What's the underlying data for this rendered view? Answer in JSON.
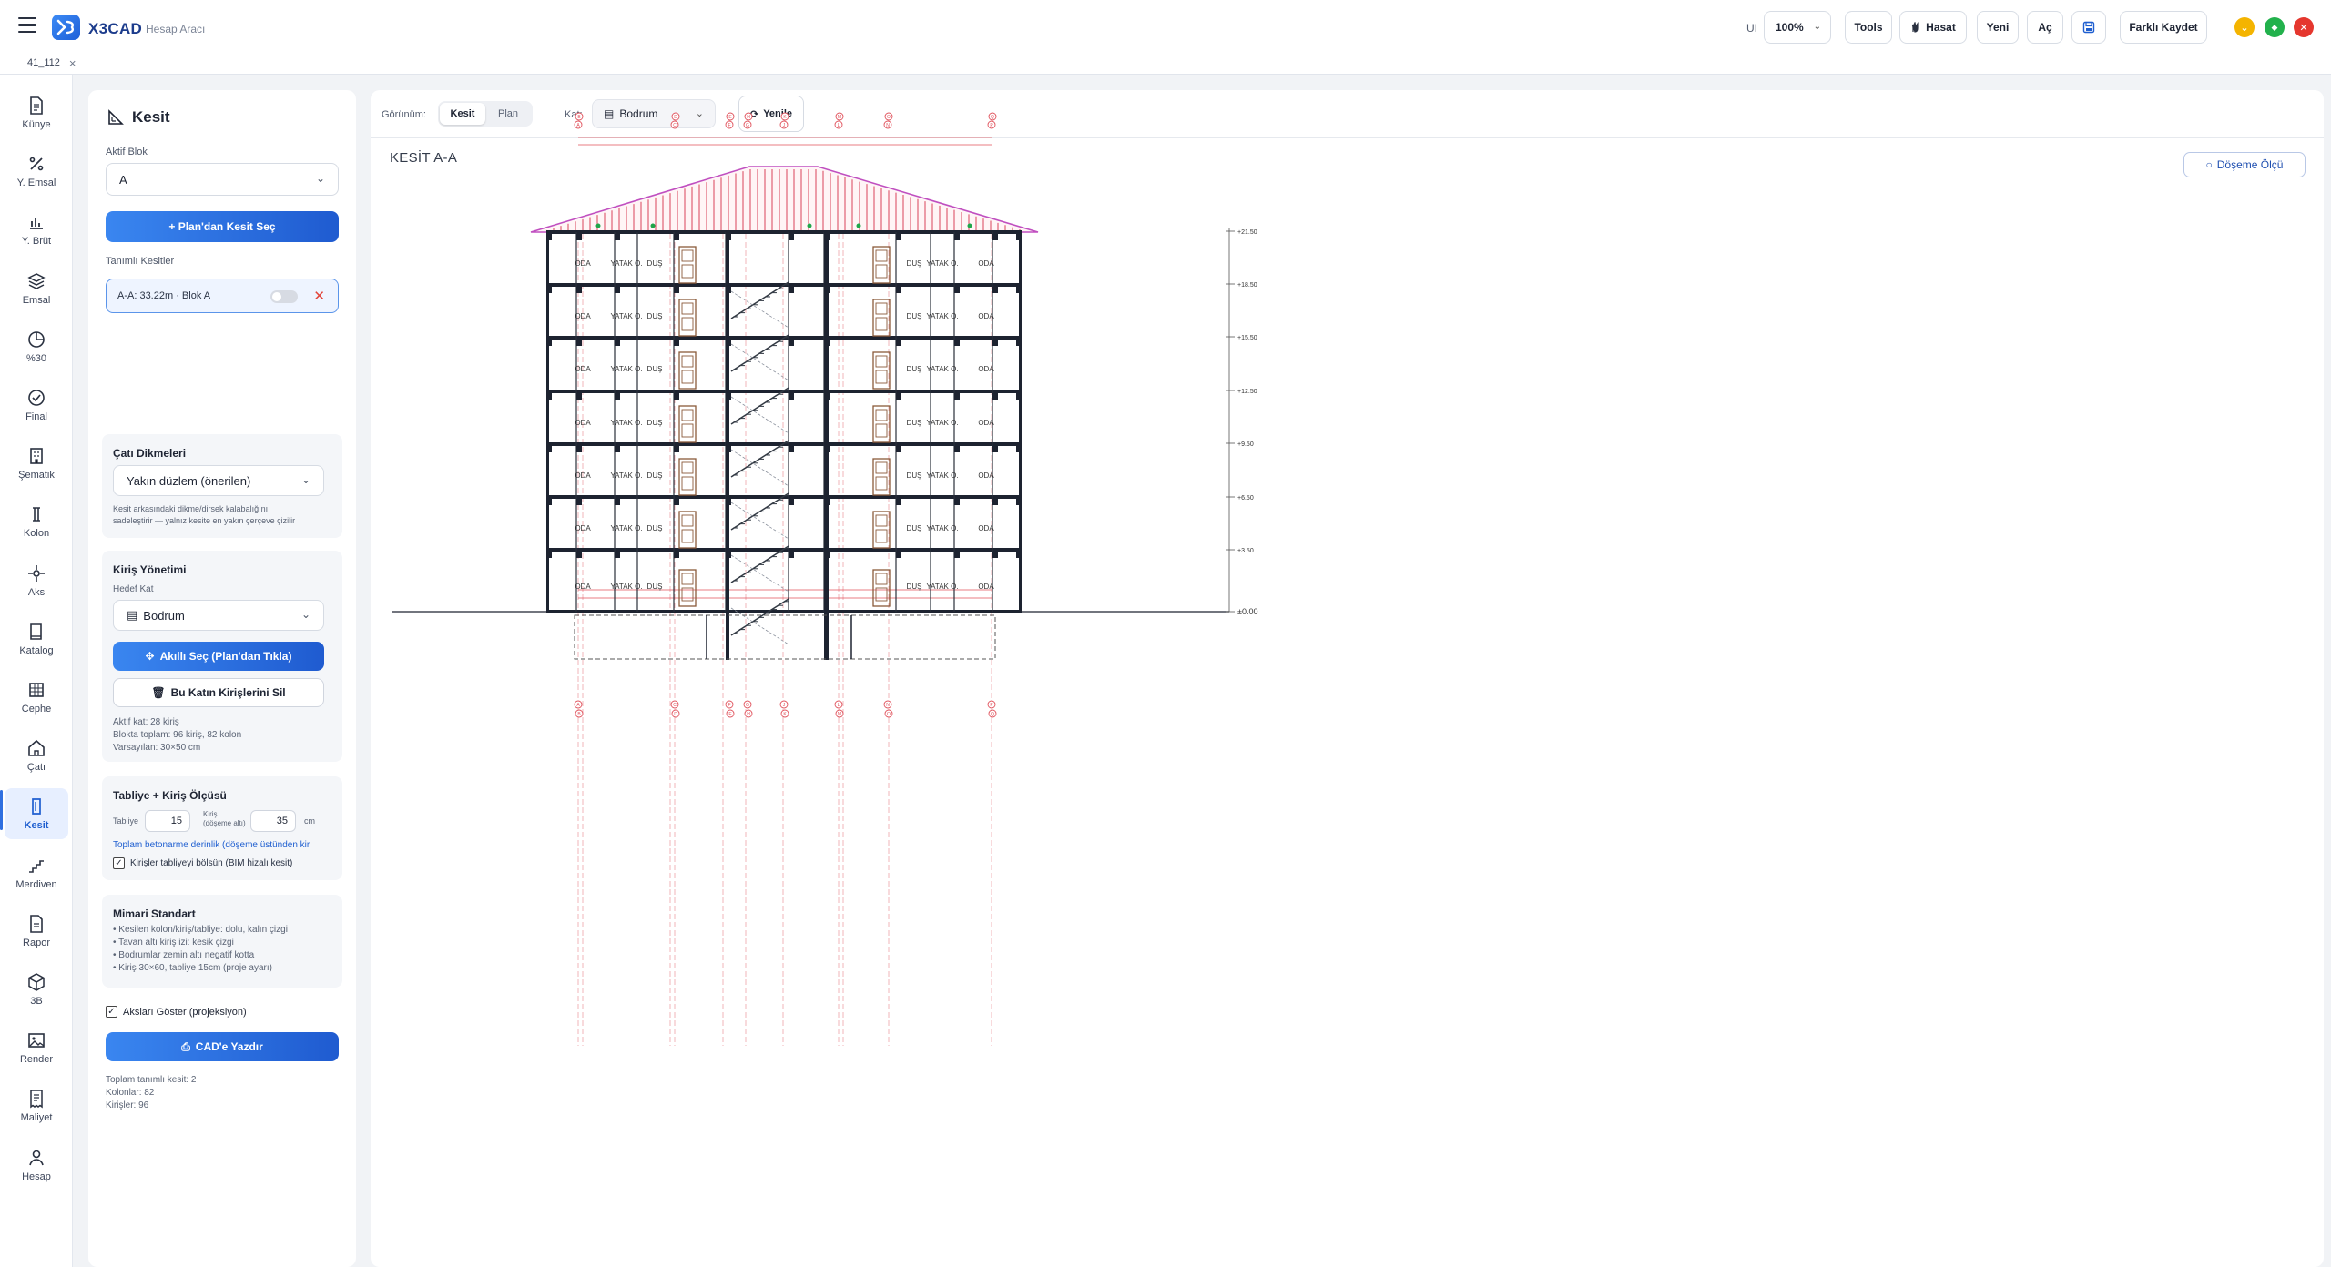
{
  "app": {
    "name": "X3CAD",
    "subtitle": "Hesap Aracı"
  },
  "file_tab": {
    "name": "41_112",
    "close": "×"
  },
  "toolbar": {
    "ui_label": "UI",
    "zoom_value": "100%",
    "tools": "Tools",
    "hasat": "Hasat",
    "yeni": "Yeni",
    "ac": "Aç",
    "farkli_kaydet": "Farklı Kaydet"
  },
  "window_controls": {
    "minimize_color": "#f4b400",
    "maximize_color": "#22b14c",
    "close_color": "#e5372e"
  },
  "nav": [
    {
      "label": "Künye",
      "icon": "document-icon"
    },
    {
      "label": "Y. Emsal",
      "icon": "percent-icon"
    },
    {
      "label": "Y. Brüt",
      "icon": "bar-chart-icon"
    },
    {
      "label": "Emsal",
      "icon": "layers-icon"
    },
    {
      "label": "%30",
      "icon": "pie-icon"
    },
    {
      "label": "Final",
      "icon": "check-circle-icon"
    },
    {
      "label": "Şematik",
      "icon": "building-icon"
    },
    {
      "label": "Kolon",
      "icon": "column-icon"
    },
    {
      "label": "Aks",
      "icon": "crosshair-icon"
    },
    {
      "label": "Katalog",
      "icon": "book-icon"
    },
    {
      "label": "Cephe",
      "icon": "facade-icon"
    },
    {
      "label": "Çatı",
      "icon": "home-icon"
    },
    {
      "label": "Kesit",
      "icon": "section-icon",
      "active": true
    },
    {
      "label": "Merdiven",
      "icon": "stairs-icon"
    },
    {
      "label": "Rapor",
      "icon": "report-icon"
    },
    {
      "label": "3B",
      "icon": "cube-icon"
    },
    {
      "label": "Render",
      "icon": "image-icon"
    },
    {
      "label": "Maliyet",
      "icon": "receipt-icon"
    },
    {
      "label": "Hesap",
      "icon": "user-icon"
    }
  ],
  "panel": {
    "title": "Kesit",
    "aktif_blok_label": "Aktif Blok",
    "aktif_blok_value": "A",
    "plandan_kesit_sec": "+ Plan'dan Kesit Seç",
    "tanimli_kesitler_label": "Tanımlı Kesitler",
    "section_item": "A-A: 33.22m · Blok A",
    "cati_dikmeleri": {
      "title": "Çatı Dikmeleri",
      "value": "Yakın düzlem (önerilen)",
      "help": [
        "Kesit arkasındaki dikme/dirsek kalabalığını",
        "sadeleştirir — yalnız kesite en yakın çerçeve çizilir"
      ]
    },
    "kiris_yonetimi": {
      "title": "Kiriş Yönetimi",
      "hedef_kat_label": "Hedef Kat",
      "hedef_kat_value": "Bodrum",
      "akilli_sec": "Akıllı Seç (Plan'dan Tıkla)",
      "sil": "Bu Katın Kirişlerini Sil",
      "stats": [
        "Aktif kat: 28 kiriş",
        "Blokta toplam: 96 kiriş, 82 kolon",
        "Varsayılan: 30×50 cm"
      ]
    },
    "tabliye": {
      "title": "Tabliye + Kiriş Ölçüsü",
      "tabliye_label": "Tabliye",
      "tabliye_value": "15",
      "kiris_label_1": "Kiriş",
      "kiris_label_2": "(döşeme altı)",
      "kiris_value": "35",
      "unit": "cm",
      "link": "Toplam betonarme derinlik (döşeme üstünden kir",
      "checkbox_label": "Kirişler tabliyeyi bölsün (BIM hizalı kesit)"
    },
    "mimari": {
      "title": "Mimari Standart",
      "items": [
        "• Kesilen kolon/kiriş/tabliye: dolu, kalın çizgi",
        "• Tavan altı kiriş izi: kesik çizgi",
        "• Bodrumlar zemin altı negatif kotta",
        "• Kiriş 30×60, tabliye 15cm (proje ayarı)"
      ]
    },
    "akslari_goster": "Aksları Göster (projeksiyon)",
    "cade_yazdir": "CAD'e Yazdır",
    "footer": [
      "Toplam tanımlı kesit: 2",
      "Kolonlar: 82",
      "Kirişler: 96"
    ]
  },
  "canvas": {
    "gorunum_label": "Görünüm:",
    "view_kesit": "Kesit",
    "view_plan": "Plan",
    "kat_label": "Kat:",
    "kat_value": "Bodrum",
    "yenile": "Yenile",
    "sheet_title": "KESİT A-A",
    "doseme_olcu": "Döşeme Ölçü"
  },
  "drawing": {
    "levels": [
      "+21.50",
      "+18.50",
      "+15.50",
      "+12.50",
      "+9.50",
      "+6.50",
      "+3.50",
      "±0.00"
    ],
    "room_labels_left": [
      "ODA",
      "YATAK O.",
      "DUŞ"
    ],
    "room_labels_right": [
      "DUŞ",
      "YATAK O.",
      "ODA"
    ],
    "axis_top_upper": [
      "B",
      "D",
      "E",
      "H",
      "K",
      "M",
      "O",
      "Q"
    ],
    "axis_top_lower": [
      "A",
      "C",
      "F",
      "G",
      "J",
      "L",
      "N",
      "P"
    ],
    "axis_bottom_upper": [
      "A",
      "C",
      "F",
      "G",
      "J",
      "L",
      "N",
      "P"
    ],
    "axis_bottom_lower": [
      "B",
      "D",
      "E",
      "H",
      "K",
      "M",
      "O",
      "Q"
    ],
    "colors": {
      "axis": "#e0505a",
      "roof": "#d9445a",
      "roof_outline": "#c04fc0",
      "structure": "#1d2330",
      "door": "#8a5a3a",
      "stair": "#333a44",
      "green_dot": "#1fa64a"
    }
  }
}
